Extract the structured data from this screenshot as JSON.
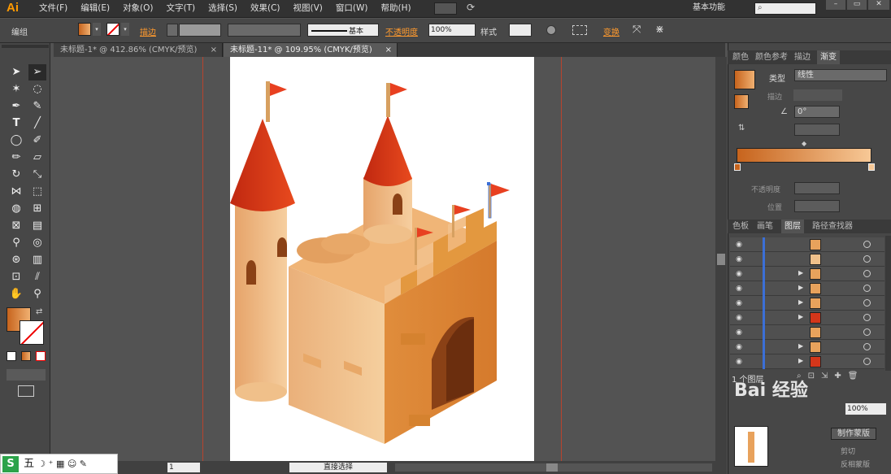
{
  "app": {
    "logo": "Ai",
    "workspace": "基本功能",
    "search_placeholder": ""
  },
  "menus": [
    "文件(F)",
    "编辑(E)",
    "对象(O)",
    "文字(T)",
    "选择(S)",
    "效果(C)",
    "视图(V)",
    "窗口(W)",
    "帮助(H)"
  ],
  "options": {
    "mode": "编组",
    "stroke_label": "描边",
    "stroke_style": "基本",
    "opacity_label": "不透明度",
    "opacity_value": "100%",
    "style_label": "样式",
    "transform_label": "变换"
  },
  "tabs": [
    {
      "label": "未标题-1* @ 412.86% (CMYK/预览)"
    },
    {
      "label": "未标题-11* @ 109.95% (CMYK/预览)"
    }
  ],
  "gradient_panel": {
    "tabs": [
      "颜色",
      "颜色参考",
      "描边",
      "渐变"
    ],
    "type_label": "类型",
    "type_value": "线性",
    "stroke_label": "描边",
    "angle_value": "0°",
    "opacity_label": "不透明度",
    "position_label": "位置"
  },
  "layers_panel": {
    "tabs": [
      "色板",
      "画笔",
      "图层",
      "路径查找器"
    ],
    "status": "1 个图层",
    "make_mask": "制作蒙版",
    "clip": "剪切",
    "invert": "反相蒙版",
    "opacity": "100%"
  },
  "status": {
    "zoom": "1",
    "tool": "直接选择"
  },
  "colors": {
    "castle": "#e8a25c",
    "roof": "#d4361a",
    "flag": "#e84020",
    "door": "#8a4116",
    "guide": "#c74a2b"
  }
}
